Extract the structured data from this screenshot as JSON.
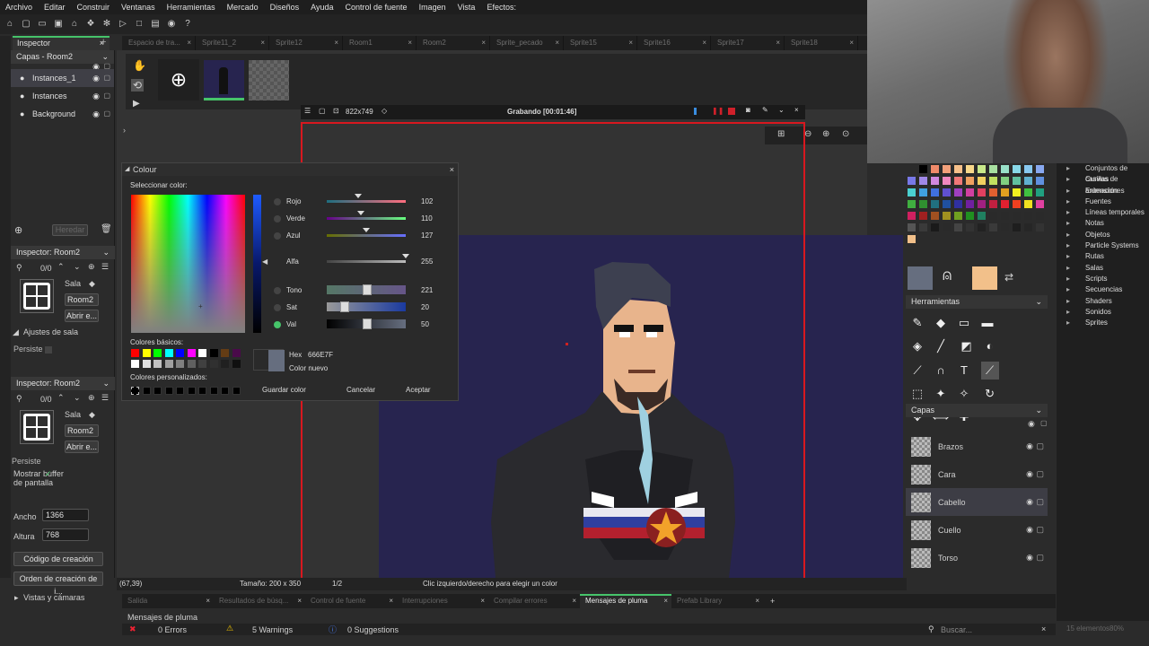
{
  "menu": [
    "Archivo",
    "Editar",
    "Construir",
    "Ventanas",
    "Herramientas",
    "Mercado",
    "Diseños",
    "Ayuda",
    "Control de fuente",
    "Imagen",
    "Vista",
    "Efectos:"
  ],
  "inspector_tab": "Inspector",
  "tabs": [
    "Espacio de tra...",
    "Sprite11_2",
    "Sprite12",
    "Room1",
    "Room2",
    "Sprite_pecado",
    "Sprite15",
    "Sprite16",
    "Sprite17",
    "Sprite18"
  ],
  "layers_panel": {
    "title": "Capas - Room2",
    "items": [
      {
        "label": "Instances_1",
        "selected": true
      },
      {
        "label": "Instances",
        "selected": false
      },
      {
        "label": "Background",
        "selected": false
      }
    ],
    "heredar": "Heredar"
  },
  "inspector1": {
    "title": "Inspector: Room2",
    "count": "0/0",
    "sala_label": "Sala",
    "room_name": "Room2",
    "open_btn": "Abrir e...",
    "ajustes": "Ajustes de sala",
    "persistent": "Persiste"
  },
  "inspector2": {
    "title": "Inspector: Room2",
    "count": "0/0",
    "sala_label": "Sala",
    "room_name": "Room2",
    "open_btn": "Abrir e...",
    "persistent": "Persiste",
    "show_buffer": "Mostrar buffer de pantalla",
    "width_label": "Ancho",
    "width_value": "1366",
    "height_label": "Altura",
    "height_value": "768",
    "creation_code_btn": "Código de creación",
    "creation_order_btn": "Orden de creación de i...",
    "views": "Vistas y cámaras"
  },
  "recording": {
    "size": "822x749",
    "status": "Grabando [00:01:46]"
  },
  "colour_dialog": {
    "title": "Colour",
    "select_label": "Seleccionar color:",
    "rows": [
      {
        "label": "Rojo",
        "value": "102",
        "fraction": 0.4
      },
      {
        "label": "Verde",
        "value": "110",
        "fraction": 0.43
      },
      {
        "label": "Azul",
        "value": "127",
        "fraction": 0.5
      },
      {
        "label": "Alfa",
        "value": "255",
        "fraction": 1.0
      },
      {
        "label": "Tono",
        "value": "221",
        "fraction": 0.5
      },
      {
        "label": "Sat",
        "value": "20",
        "fraction": 0.22
      },
      {
        "label": "Val",
        "value": "50",
        "fraction": 0.5
      }
    ],
    "basic_colors": "Colores básicos:",
    "custom_colors": "Colores personalizados:",
    "hex_label": "Hex",
    "hex_value": "666E7F",
    "new_color": "Color nuevo",
    "save_btn": "Guardar color",
    "cancel_btn": "Cancelar",
    "accept_btn": "Aceptar",
    "current_color": "#666e7f"
  },
  "status": {
    "coords": "(67,39)",
    "size": "Tamaño: 200 x 350",
    "frame": "1/2",
    "hint": "Clic izquierdo/derecho para elegir un color"
  },
  "tools_panel": {
    "title": "Herramientas"
  },
  "right_layers": {
    "title": "Capas",
    "items": [
      {
        "label": "Brazos",
        "selected": false
      },
      {
        "label": "Cara",
        "selected": false
      },
      {
        "label": "Cabello",
        "selected": true
      },
      {
        "label": "Cuello",
        "selected": false
      },
      {
        "label": "Torso",
        "selected": false
      }
    ]
  },
  "resource_tree": [
    "Conjuntos de casillas",
    "Curvas de animación",
    "Extensiones",
    "Fuentes",
    "Líneas temporales",
    "Notas",
    "Objetos",
    "Particle Systems",
    "Rutas",
    "Salas",
    "Scripts",
    "Secuencias",
    "Shaders",
    "Sonidos",
    "Sprites"
  ],
  "bottom_tabs": [
    {
      "label": "Salida",
      "active": false
    },
    {
      "label": "Resultados de búsq...",
      "active": false
    },
    {
      "label": "Control de fuente",
      "active": false
    },
    {
      "label": "Interrupciones",
      "active": false
    },
    {
      "label": "Compilar errores",
      "active": false
    },
    {
      "label": "Mensajes de pluma",
      "active": true
    },
    {
      "label": "Prefab Library",
      "active": false
    }
  ],
  "messages": {
    "title": "Mensajes de pluma",
    "errors": "0 Errors",
    "warnings": "5 Warnings",
    "suggestions": "0 Suggestions",
    "search_placeholder": "Buscar...",
    "count": "15 elementos80%"
  }
}
